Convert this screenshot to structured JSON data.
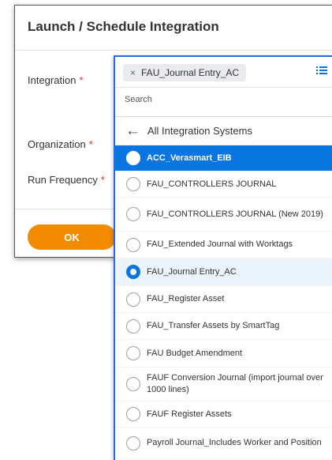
{
  "dialog": {
    "title": "Launch / Schedule Integration",
    "fields": [
      {
        "label": "Integration",
        "required": "*"
      },
      {
        "label": "Organization",
        "required": "*"
      },
      {
        "label": "Run Frequency",
        "required": "*"
      }
    ],
    "ok_label": "OK"
  },
  "prompt": {
    "selected_chip": "FAU_Journal Entry_AC",
    "chip_remove": "×",
    "search_placeholder": "Search",
    "back_label": "All Integration Systems",
    "options": [
      {
        "label": "ACC_Verasmart_EIB",
        "state": "active"
      },
      {
        "label": "FAU_CONTROLLERS JOURNAL",
        "state": ""
      },
      {
        "label": "FAU_CONTROLLERS JOURNAL (New 2019)",
        "state": ""
      },
      {
        "label": "FAU_Extended Journal with Worktags",
        "state": ""
      },
      {
        "label": "FAU_Journal Entry_AC",
        "state": "checked"
      },
      {
        "label": "FAU_Register Asset",
        "state": ""
      },
      {
        "label": "FAU_Transfer Assets by SmartTag",
        "state": ""
      },
      {
        "label": "FAU Budget Amendment",
        "state": ""
      },
      {
        "label": "FAUF Conversion Journal (import journal over 1000 lines)",
        "state": ""
      },
      {
        "label": "FAUF Register Assets",
        "state": ""
      },
      {
        "label": "Payroll Journal_Includes Worker and Position",
        "state": ""
      }
    ]
  },
  "colors": {
    "accent_blue": "#0875e1",
    "ok_orange": "#f38b00",
    "required_red": "#de2e21"
  },
  "icons": {
    "chip_remove": "close-icon",
    "list_toggle": "list-icon",
    "back": "arrow-left-icon",
    "option": "radio-icon"
  }
}
